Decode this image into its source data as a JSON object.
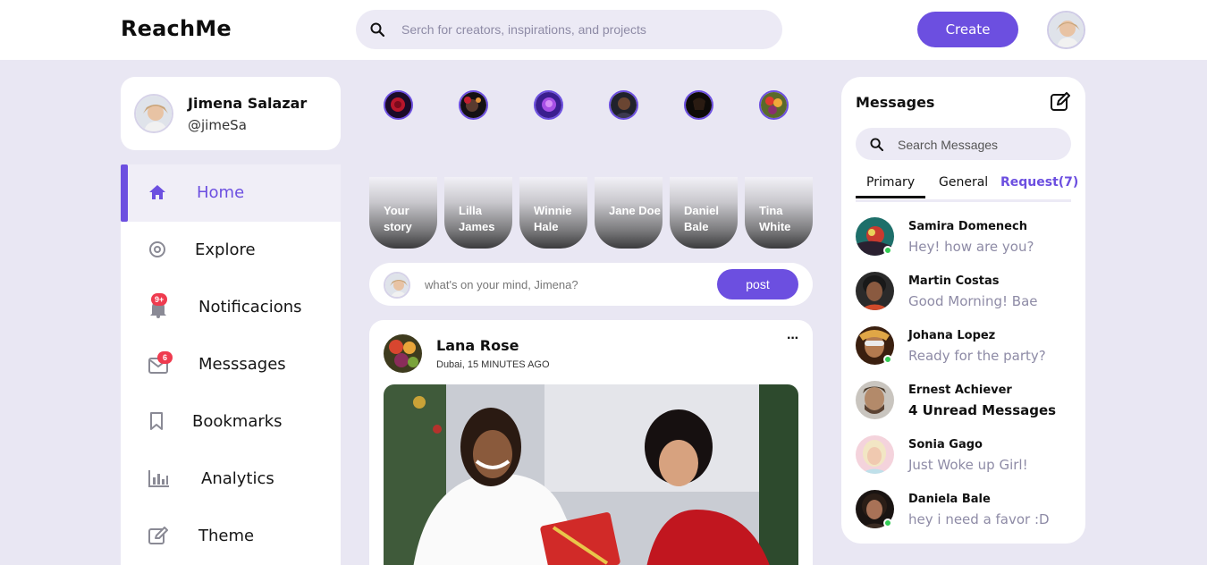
{
  "nav": {
    "logo": "ReachMe",
    "search_placeholder": "Serch for creators, inspirations, and projects",
    "create_label": "Create"
  },
  "profile": {
    "name": "Jimena Salazar",
    "handle": "@jimeSa"
  },
  "sidebar": {
    "items": [
      {
        "label": "Home",
        "icon": "home-icon",
        "active": true
      },
      {
        "label": "Explore",
        "icon": "compass-icon"
      },
      {
        "label": "Notificacions",
        "icon": "bell-icon",
        "badge": "9+"
      },
      {
        "label": "Messsages",
        "icon": "mail-icon",
        "badge": "6"
      },
      {
        "label": "Bookmarks",
        "icon": "bookmark-icon"
      },
      {
        "label": "Analytics",
        "icon": "chart-icon"
      },
      {
        "label": "Theme",
        "icon": "palette-icon"
      }
    ]
  },
  "stories": [
    {
      "label": "Your story"
    },
    {
      "label": "Lilla James"
    },
    {
      "label": "Winnie Hale"
    },
    {
      "label": "Jane Doe"
    },
    {
      "label": "Daniel Bale"
    },
    {
      "label": "Tina White"
    }
  ],
  "compose": {
    "placeholder": "what's on your mind, Jimena?",
    "post_label": "post"
  },
  "feed": {
    "author": "Lana Rose",
    "meta": "Dubai, 15 MINUTES AGO",
    "more": "···"
  },
  "messages": {
    "title": "Messages",
    "search_placeholder": "Search Messages",
    "tabs": [
      "Primary",
      "General",
      "Request(7)"
    ],
    "list": [
      {
        "name": "Samira Domenech",
        "text": "Hey! how are you?",
        "online": true
      },
      {
        "name": "Martin Costas",
        "text": "Good Morning! Bae",
        "online": false
      },
      {
        "name": "Johana Lopez",
        "text": "Ready for the party?",
        "online": true
      },
      {
        "name": "Ernest Achiever",
        "text": "4 Unread Messages",
        "online": false,
        "bold": true
      },
      {
        "name": "Sonia Gago",
        "text": "Just Woke up Girl!",
        "online": false
      },
      {
        "name": "Daniela Bale",
        "text": "hey i need a favor :D",
        "online": true
      }
    ]
  },
  "colors": {
    "accent": "#6c4fe0",
    "background": "#e9e7f3",
    "badge": "#ef3b4f",
    "online": "#33cc55"
  }
}
